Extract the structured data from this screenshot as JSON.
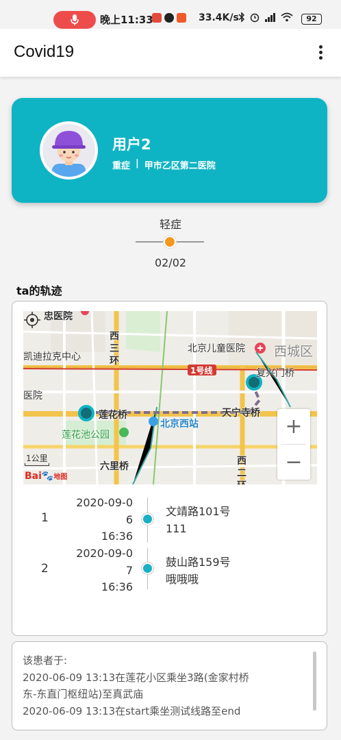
{
  "status_bar": {
    "time": "晚上11:33",
    "speed": "33.4K/s",
    "battery": "92"
  },
  "app": {
    "title": "Covid19"
  },
  "user": {
    "name": "用户2",
    "condition": "重症",
    "separator": "|",
    "hospital": "甲市乙区第二医院"
  },
  "slider": {
    "label": "轻症",
    "count": "02/02",
    "fraction": 0.5
  },
  "track_section": {
    "title": "ta的轨迹"
  },
  "map": {
    "labels": {
      "zonghui": "忠医院",
      "west3": "西三环",
      "kaidi": "凯迪拉克中心",
      "children": "北京儿童医院",
      "xicheng": "西城区",
      "line1": "1号线",
      "fuxingmen": "复兴门桥",
      "hospital_left": "医院",
      "lianhuaqiao": "莲花桥",
      "tianning": "天宁寺桥",
      "bjxizhan": "北京西站",
      "lianhuachi": "莲花池公园",
      "liuliqiao": "六里桥",
      "west2": "西二环"
    },
    "scale": "1公里",
    "brand": "Bai",
    "brand_tail": "地图",
    "zoom_in": "+",
    "zoom_out": "−"
  },
  "timeline": [
    {
      "index": "1",
      "time_lines": [
        "2020-09-0",
        "6",
        "16:36"
      ],
      "place_lines": [
        "文靖路101号",
        "111"
      ]
    },
    {
      "index": "2",
      "time_lines": [
        "2020-09-0",
        "7",
        "16:36"
      ],
      "place_lines": [
        "鼓山路159号",
        "哦哦哦"
      ]
    }
  ],
  "description": {
    "lines": [
      "该患者于:",
      "2020-06-09 13:13在莲花小区乘坐3路(金家村桥",
      "东-东直门枢纽站)至真武庙",
      "2020-06-09 13:13在start乘坐测试线路至end"
    ]
  },
  "colors": {
    "accent": "#0fb4c4",
    "slider_thumb": "#f5981e",
    "mic": "#ee4b4b",
    "timeline_dot": "#19b0c4"
  }
}
